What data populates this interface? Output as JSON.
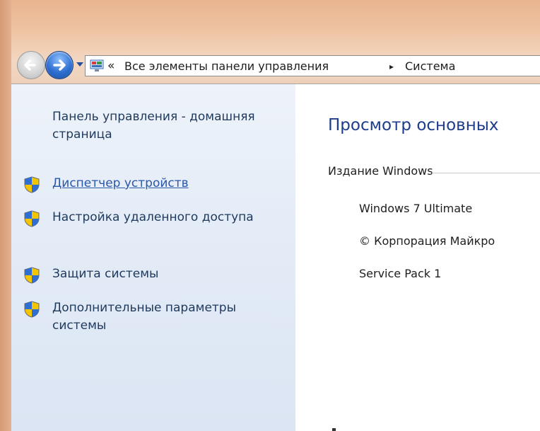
{
  "address_bar": {
    "overflow_chevron": "«",
    "crumb_1": "Все элементы панели управления",
    "separator": "▸",
    "crumb_2": "Система"
  },
  "sidebar": {
    "home_link": "Панель управления - домашняя страница",
    "tasks": [
      {
        "label": "Диспетчер устройств",
        "icon": "uac-shield-icon"
      },
      {
        "label": "Настройка удаленного доступа",
        "icon": "uac-shield-icon"
      },
      {
        "label": "Защита системы",
        "icon": "uac-shield-icon"
      },
      {
        "label": "Дополнительные параметры системы",
        "icon": "uac-shield-icon"
      }
    ]
  },
  "main": {
    "title": "Просмотр основных",
    "edition_section": {
      "header": "Издание Windows",
      "edition": "Windows 7 Ultimate",
      "copyright": "© Корпорация Майкро",
      "service_pack": "Service Pack 1"
    }
  },
  "colors": {
    "link_blue": "#2b57a8",
    "title_blue": "#1e3c8c",
    "sidebar_text": "#1e395b",
    "sidebar_bg": "#e4ecf7",
    "titlebar_tint": "#efd3bd"
  }
}
